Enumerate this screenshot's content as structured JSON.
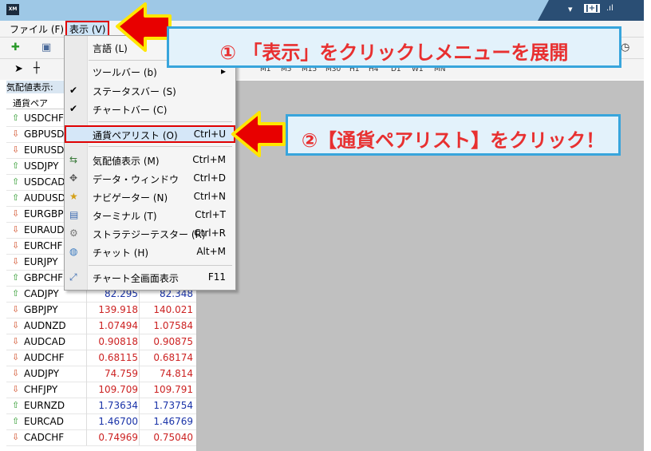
{
  "window": {
    "logo": "XM",
    "controls": [
      "▾",
      "ǀ+ǀ",
      ".ıl"
    ]
  },
  "menubar": {
    "file": "ファイル (F)",
    "view": "表示 (V)"
  },
  "timeframes": [
    "M1",
    "M5",
    "M15",
    "M30",
    "H1",
    "H4",
    "D1",
    "W1",
    "MN"
  ],
  "market_watch": {
    "title": "気配値表示:",
    "col_symbol": "通貨ペア",
    "rows": [
      {
        "dir": "up",
        "symbol": "USDCHF",
        "bid": "",
        "ask": ""
      },
      {
        "dir": "down",
        "symbol": "GBPUSD",
        "bid": "",
        "ask": ""
      },
      {
        "dir": "down",
        "symbol": "EURUSD",
        "bid": "",
        "ask": ""
      },
      {
        "dir": "up",
        "symbol": "USDJPY",
        "bid": "",
        "ask": ""
      },
      {
        "dir": "up",
        "symbol": "USDCAD",
        "bid": "",
        "ask": ""
      },
      {
        "dir": "up",
        "symbol": "AUDUSD",
        "bid": "",
        "ask": ""
      },
      {
        "dir": "down",
        "symbol": "EURGBP",
        "bid": "",
        "ask": ""
      },
      {
        "dir": "down",
        "symbol": "EURAUD",
        "bid": "",
        "ask": ""
      },
      {
        "dir": "down",
        "symbol": "EURCHF",
        "bid": "",
        "ask": ""
      },
      {
        "dir": "down",
        "symbol": "EURJPY",
        "bid": "",
        "ask": ""
      },
      {
        "dir": "up",
        "symbol": "GBPCHF",
        "bid": "",
        "ask": ""
      },
      {
        "dir": "up",
        "symbol": "CADJPY",
        "bid": "82.295",
        "ask": "82.348",
        "color": "blue"
      },
      {
        "dir": "down",
        "symbol": "GBPJPY",
        "bid": "139.918",
        "ask": "140.021",
        "color": "red"
      },
      {
        "dir": "down",
        "symbol": "AUDNZD",
        "bid": "1.07494",
        "ask": "1.07584",
        "color": "red"
      },
      {
        "dir": "down",
        "symbol": "AUDCAD",
        "bid": "0.90818",
        "ask": "0.90875",
        "color": "red"
      },
      {
        "dir": "down",
        "symbol": "AUDCHF",
        "bid": "0.68115",
        "ask": "0.68174",
        "color": "red"
      },
      {
        "dir": "down",
        "symbol": "AUDJPY",
        "bid": "74.759",
        "ask": "74.814",
        "color": "red"
      },
      {
        "dir": "down",
        "symbol": "CHFJPY",
        "bid": "109.709",
        "ask": "109.791",
        "color": "red"
      },
      {
        "dir": "up",
        "symbol": "EURNZD",
        "bid": "1.73634",
        "ask": "1.73754",
        "color": "blue"
      },
      {
        "dir": "up",
        "symbol": "EURCAD",
        "bid": "1.46700",
        "ask": "1.46769",
        "color": "blue"
      },
      {
        "dir": "down",
        "symbol": "CADCHF",
        "bid": "0.74969",
        "ask": "0.75040",
        "color": "red"
      }
    ]
  },
  "view_menu": {
    "language": "言語 (L)",
    "toolbar": "ツールバー (b)",
    "statusbar": "ステータスバー (S)",
    "chartbar": "チャートバー (C)",
    "symbols": "通貨ペアリスト (O)",
    "symbols_sc": "Ctrl+U",
    "market_watch": "気配値表示 (M)",
    "market_watch_sc": "Ctrl+M",
    "data_window": "データ・ウィンドウ",
    "data_window_sc": "Ctrl+D",
    "navigator": "ナビゲーター (N)",
    "navigator_sc": "Ctrl+N",
    "terminal": "ターミナル (T)",
    "terminal_sc": "Ctrl+T",
    "tester": "ストラテジーテスター (R)",
    "tester_sc": "Ctrl+R",
    "chat": "チャット (H)",
    "chat_sc": "Alt+M",
    "fullscreen": "チャート全画面表示",
    "fullscreen_sc": "F11"
  },
  "annotations": {
    "step1": "① 「表示」をクリックしメニューを展開",
    "step2": "②【通貨ペアリスト】をクリック！"
  },
  "colors": {
    "bid_up": "#1a33a8",
    "bid_down": "#cc2222",
    "arrow_up": "#2e9a2e",
    "arrow_down": "#d2502a",
    "callout_text": "#e83030",
    "callout_border": "#38a5dc",
    "arrow_red": "#e80000",
    "arrow_yellow": "#ffe600"
  }
}
